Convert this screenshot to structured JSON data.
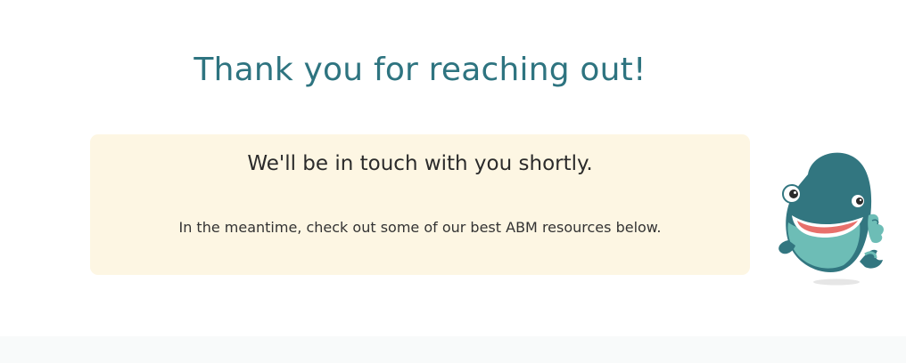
{
  "header": {
    "title": "Thank you for reaching out!"
  },
  "notice": {
    "heading": "We'll be in touch with you shortly.",
    "body": "In the meantime, check out some of our best ABM resources below."
  },
  "colors": {
    "title": "#2e7480",
    "notice_background": "#fdf6e3",
    "whale_body": "#327680",
    "whale_belly": "#6dbdb6",
    "whale_mouth": "#e8706b"
  },
  "mascot": {
    "icon": "whale-mascot-icon"
  }
}
